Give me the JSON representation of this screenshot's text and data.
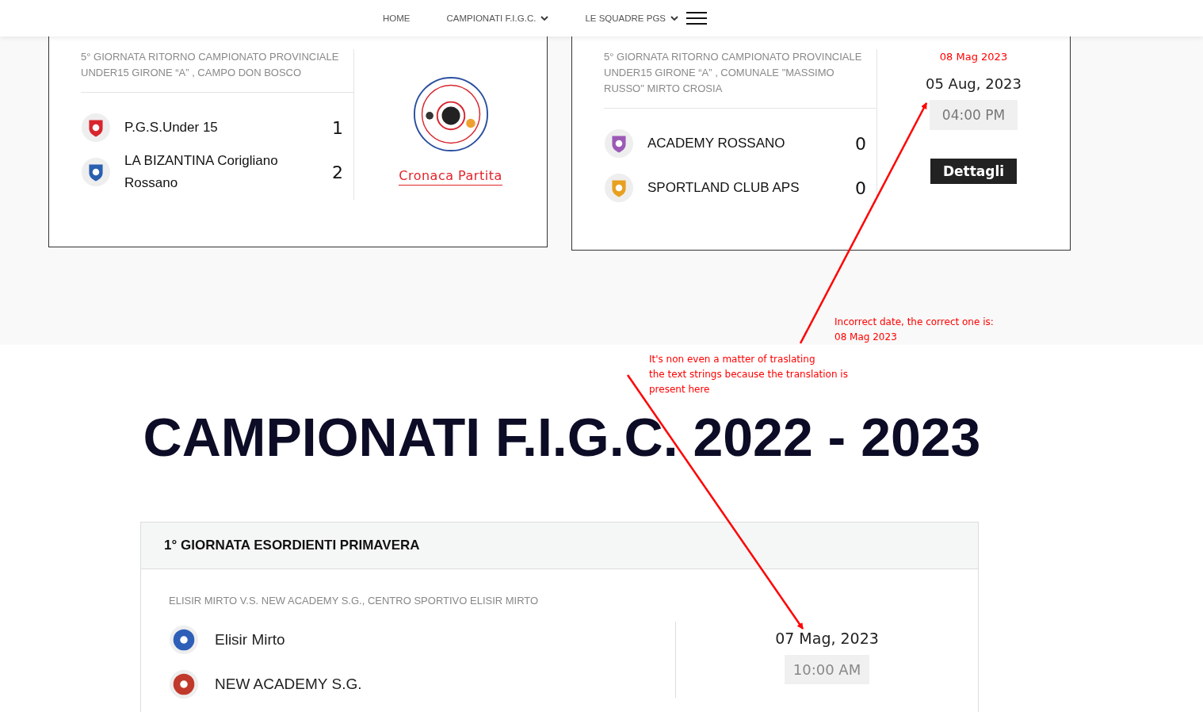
{
  "nav": {
    "items": [
      {
        "label": "HOME",
        "dropdown": false
      },
      {
        "label": "CAMPIONATI F.I.G.C.",
        "dropdown": true
      },
      {
        "label": "LE SQUADRE PGS",
        "dropdown": true
      }
    ]
  },
  "matches": [
    {
      "title": "5° GIORNATA RITORNO CAMPIONATO PROVINCIALE UNDER15 GIRONE “A” , CAMPO DON BOSCO",
      "teams": [
        {
          "name": "P.G.S.Under 15",
          "score": "1",
          "color": "#d8252e"
        },
        {
          "name": "LA BIZANTINA Corigliano Rossano",
          "score": "2",
          "color": "#2a5fb0"
        }
      ],
      "aside": {
        "kind": "report",
        "link": "Cronaca Partita"
      }
    },
    {
      "title": "5° GIORNATA RITORNO CAMPIONATO PROVINCIALE UNDER15 GIRONE “A” , COMUNALE \"MASSIMO RUSSO\" MIRTO CROSIA",
      "teams": [
        {
          "name": "ACADEMY ROSSANO",
          "score": "0",
          "color": "#9b59b6"
        },
        {
          "name": "SPORTLAND CLUB APS",
          "score": "0",
          "color": "#e8a020"
        }
      ],
      "aside": {
        "kind": "schedule",
        "note": "08 Mag 2023",
        "date": "05 Aug, 2023",
        "time": "04:00 PM",
        "button": "Dettagli"
      }
    }
  ],
  "annotations": [
    {
      "lines": [
        "Incorrect date, the correct one is:",
        "08 Mag 2023"
      ]
    },
    {
      "lines": [
        "It's non even a matter of traslating",
        "the text strings because the translation is",
        "present here"
      ]
    }
  ],
  "heading": "CAMPIONATI F.I.G.C. 2022 - 2023",
  "championship": {
    "round_title": "1° GIORNATA ESORDIENTI PRIMAVERA",
    "match": {
      "title": "ELISIR MIRTO V.S. NEW ACADEMY S.G., CENTRO SPORTIVO ELISIR MIRTO",
      "teams": [
        {
          "name": "Elisir Mirto",
          "color": "#2d5fb8"
        },
        {
          "name": "NEW ACADEMY S.G.",
          "color": "#c0392b"
        }
      ],
      "date": "07 Mag, 2023",
      "time": "10:00 AM"
    }
  }
}
